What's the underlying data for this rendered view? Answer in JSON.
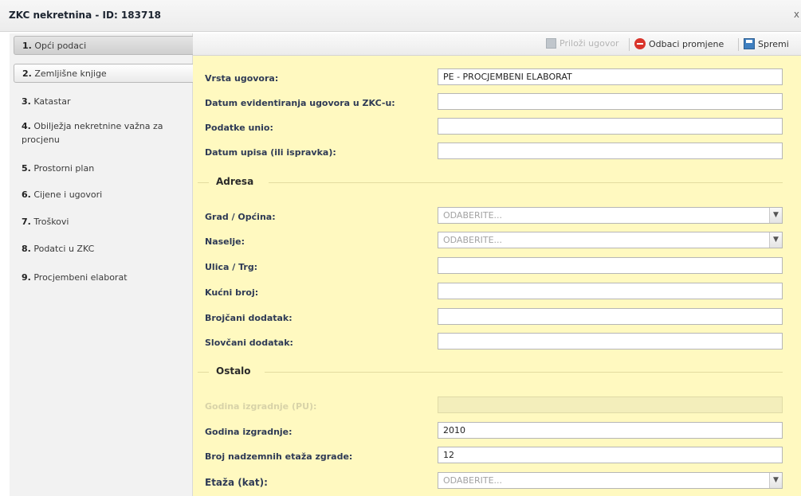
{
  "window": {
    "title": "ZKC nekretnina - ID: 183718",
    "close": "x"
  },
  "sidebar": {
    "items": [
      {
        "num": "1.",
        "label": "Opći podaci"
      },
      {
        "num": "2.",
        "label": "Zemljišne knjige"
      },
      {
        "num": "3.",
        "label": "Katastar"
      },
      {
        "num": "4.",
        "label": "Obilježja nekretnine važna za",
        "label2": "procjenu"
      },
      {
        "num": "5.",
        "label": "Prostorni plan"
      },
      {
        "num": "6.",
        "label": "Cijene i ugovori"
      },
      {
        "num": "7.",
        "label": "Troškovi"
      },
      {
        "num": "8.",
        "label": "Podatci u ZKC"
      },
      {
        "num": "9.",
        "label": "Procjembeni elaborat"
      }
    ]
  },
  "toolbar": {
    "attach_label": "Priloži ugovor",
    "discard_label": "Odbaci promjene",
    "save_label": "Spremi"
  },
  "form": {
    "contract_type": {
      "label": "Vrsta ugovora:",
      "value": "PE - PROCJEMBENI ELABORAT"
    },
    "entry_date": {
      "label": "Datum evidentiranja ugovora u ZKC-u:",
      "value": ""
    },
    "entered_by": {
      "label": "Podatke unio:",
      "value": ""
    },
    "record_date": {
      "label": "Datum upisa (ili ispravka):",
      "value": ""
    },
    "address_section": "Adresa",
    "city": {
      "label": "Grad / Općina:",
      "value": "ODABERITE..."
    },
    "settlement": {
      "label": "Naselje:",
      "value": "ODABERITE..."
    },
    "street": {
      "label": "Ulica / Trg:",
      "value": ""
    },
    "house_number": {
      "label": "Kućni broj:",
      "value": ""
    },
    "number_suffix": {
      "label": "Brojčani dodatak:",
      "value": ""
    },
    "letter_suffix": {
      "label": "Slovčani dodatak:",
      "value": ""
    },
    "other_section": "Ostalo",
    "build_year_pu": {
      "label": "Godina izgradnje (PU):",
      "value": ""
    },
    "build_year": {
      "label": "Godina izgradnje:",
      "value": "2010"
    },
    "floors_above": {
      "label": "Broj nadzemnih etaža zgrade:",
      "value": "12"
    },
    "floor": {
      "label": "Etaža (kat):",
      "value": "ODABERITE..."
    }
  }
}
